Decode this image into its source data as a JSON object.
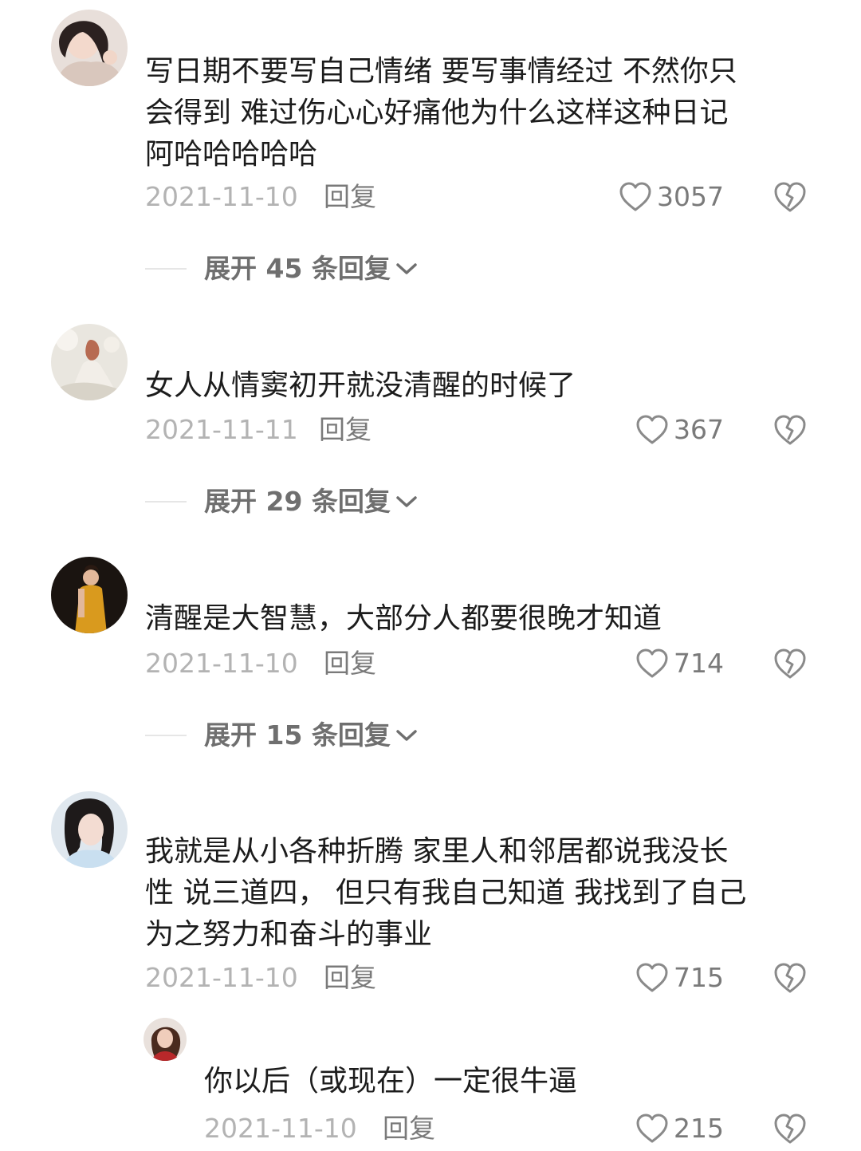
{
  "comments": [
    {
      "text_lines": [
        "写日期不要写自己情绪 要写事情经过 不然你只",
        "会得到 难过伤心心好痛他为什么这样这种日记",
        "阿哈哈哈哈哈"
      ],
      "date": "2021-11-10",
      "reply_label": "回复",
      "likes": "3057",
      "expand_label": "展开 45 条回复"
    },
    {
      "text_lines": [
        "女人从情窦初开就没清醒的时候了"
      ],
      "date": "2021-11-11",
      "reply_label": "回复",
      "likes": "367",
      "expand_label": "展开 29 条回复"
    },
    {
      "text_lines": [
        "清醒是大智慧，大部分人都要很晚才知道"
      ],
      "date": "2021-11-10",
      "reply_label": "回复",
      "likes": "714",
      "expand_label": "展开 15 条回复"
    },
    {
      "text_lines": [
        "我就是从小各种折腾 家里人和邻居都说我没长",
        "性 说三道四， 但只有我自己知道 我找到了自己",
        "为之努力和奋斗的事业"
      ],
      "date": "2021-11-10",
      "reply_label": "回复",
      "likes": "715"
    }
  ],
  "reply": {
    "text": "你以后（或现在）一定很牛逼",
    "date": "2021-11-10",
    "reply_label": "回复",
    "likes": "215"
  },
  "icons": {
    "like": "heart-outline-icon",
    "dislike": "broken-heart-icon",
    "expand": "chevron-down-icon"
  },
  "colors": {
    "text": "#1c1c1c",
    "date": "#b3b3b3",
    "secondary": "#7a7a7a"
  }
}
